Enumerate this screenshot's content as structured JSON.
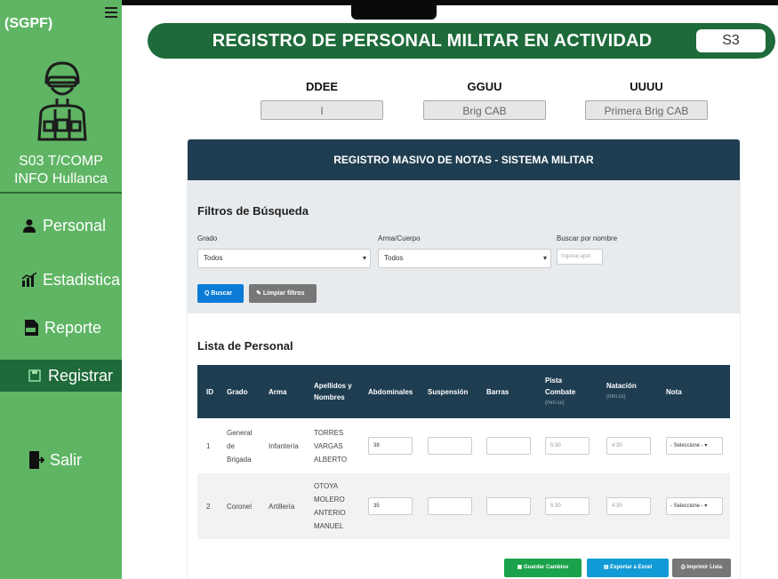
{
  "sidebar": {
    "brand": "(SGPF)",
    "user_line1": "S03 T/COMP",
    "user_line2": "INFO Hullanca",
    "items": [
      {
        "label": "Personal",
        "icon": "user-icon"
      },
      {
        "label": "Estadistica",
        "icon": "chart-icon"
      },
      {
        "label": "Reporte",
        "icon": "pdf-icon"
      },
      {
        "label": "Registrar",
        "icon": "save-icon"
      },
      {
        "label": "Salir",
        "icon": "exit-icon"
      }
    ],
    "active_index": 3
  },
  "header": {
    "title": "REGISTRO DE  PERSONAL MILITAR EN ACTIVIDAD",
    "tag": "S3"
  },
  "units": [
    {
      "label": "DDEE",
      "value": "I"
    },
    {
      "label": "GGUU",
      "value": "Brig CAB"
    },
    {
      "label": "UUUU",
      "value": "Primera Brig CAB"
    }
  ],
  "card": {
    "title": "REGISTRO MASIVO DE NOTAS - SISTEMA MILITAR",
    "filters_title": "Filtros de Búsqueda",
    "filters": {
      "grado_label": "Grado",
      "grado_value": "Todos",
      "arma_label": "Arma/Cuerpo",
      "arma_value": "Todos",
      "buscar_label": "Buscar por nombre",
      "buscar_placeholder": "Ingrese apel"
    },
    "btn_buscar": "Q Buscar",
    "btn_limpiar": "Limpiar filtros",
    "list_title": "Lista de Personal"
  },
  "table": {
    "headers": {
      "id": "ID",
      "grado": "Grado",
      "arma": "Arma",
      "apellidos": "Apellidos y Nombres",
      "abdominales": "Abdominales",
      "suspension": "Suspensión",
      "barras": "Barras",
      "pista": "Pista Combate",
      "pista_sub": "(mm:ss)",
      "natacion": "Natación",
      "natacion_sub": "(mm:ss)",
      "nota": "Nota"
    },
    "rows": [
      {
        "id": "1",
        "grado": "General de Brigada",
        "arma": "Infantería",
        "nombre": "TORRES VARGAS ALBERTO",
        "abdominales": "38",
        "suspension": "",
        "barras": "",
        "pista": "5:30",
        "natacion": "4:30",
        "nota": "- Seleccione -"
      },
      {
        "id": "2",
        "grado": "Coronel",
        "arma": "Artillería",
        "nombre": "OTOYA MOLERO ANTERIO MANUEL",
        "abdominales": "35",
        "suspension": "",
        "barras": "",
        "pista": "5:30",
        "natacion": "4:30",
        "nota": "- Seleccione -"
      }
    ]
  },
  "actions": {
    "guardar": "Guardar Cambios",
    "exportar": "Exportar a Excel",
    "imprimir": "Imprimir Lista"
  },
  "colors": {
    "sidebar": "#5fb564",
    "header": "#1e6a3a",
    "card_header": "#1f3d50",
    "btn_blue": "#0a7bd6",
    "btn_green": "#1aa34a",
    "btn_teal": "#119bd6",
    "btn_gray": "#777777"
  }
}
